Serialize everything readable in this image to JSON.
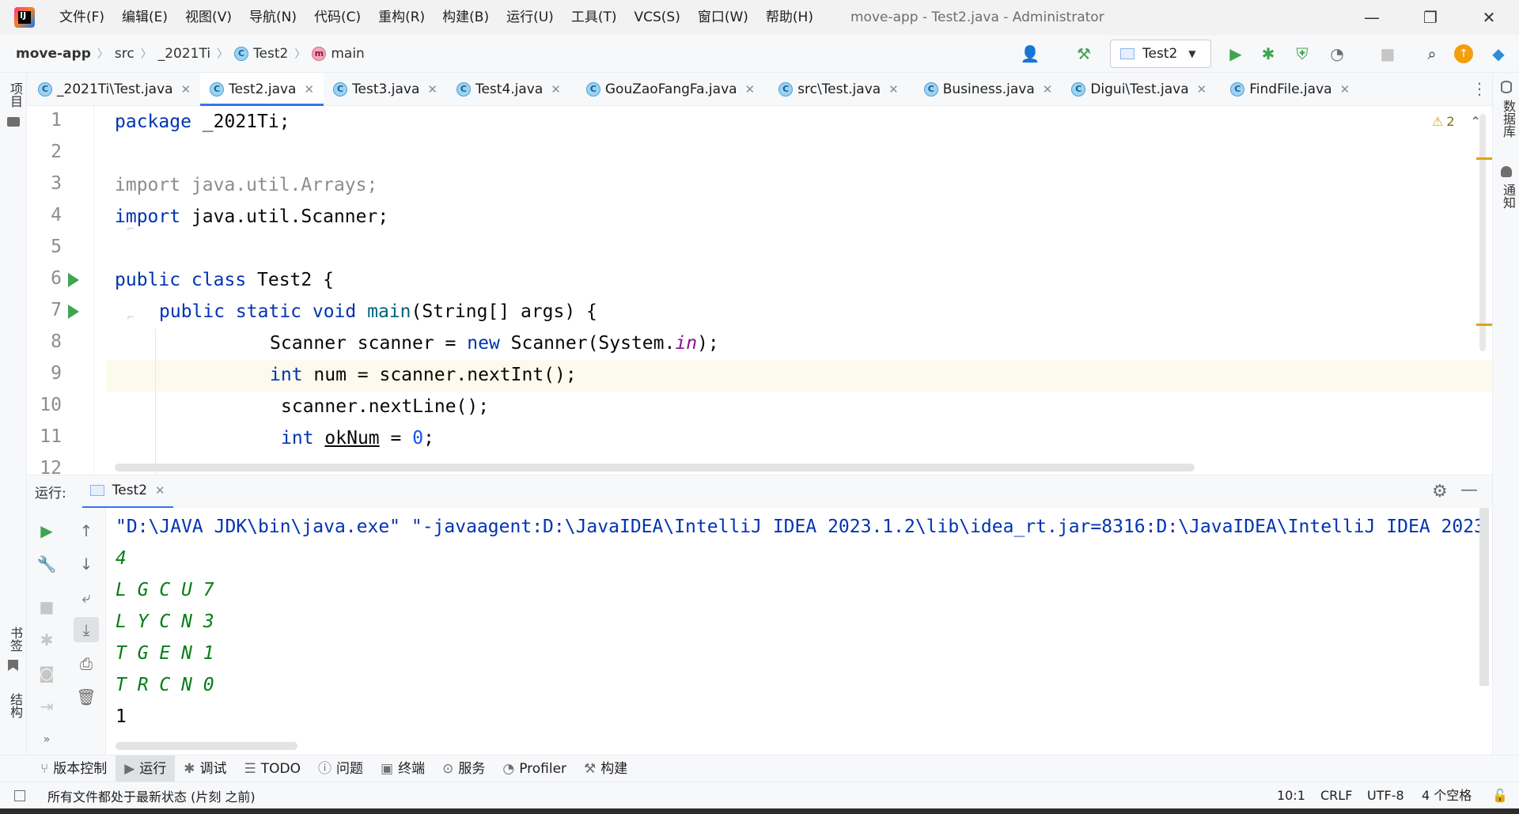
{
  "menu": [
    "文件(F)",
    "编辑(E)",
    "视图(V)",
    "导航(N)",
    "代码(C)",
    "重构(R)",
    "构建(B)",
    "运行(U)",
    "工具(T)",
    "VCS(S)",
    "窗口(W)",
    "帮助(H)"
  ],
  "window_title": "move-app - Test2.java - Administrator",
  "breadcrumb": {
    "project": "move-app",
    "src": "src",
    "package": "_2021Ti",
    "class": "Test2",
    "method": "main"
  },
  "run_config": "Test2",
  "left_stripe": {
    "project": "项目",
    "bookmarks": "书签",
    "structure": "结构"
  },
  "right_stripe": {
    "database": "数据库",
    "notifications": "通知"
  },
  "tabs": [
    {
      "label": "_2021Ti\\Test.java"
    },
    {
      "label": "Test2.java"
    },
    {
      "label": "Test3.java"
    },
    {
      "label": "Test4.java"
    },
    {
      "label": "GouZaoFangFa.java"
    },
    {
      "label": "src\\Test.java"
    },
    {
      "label": "Business.java"
    },
    {
      "label": "Digui\\Test.java"
    },
    {
      "label": "FindFile.java"
    }
  ],
  "warnings": "2",
  "line_numbers": [
    "1",
    "2",
    "3",
    "4",
    "5",
    "6",
    "7",
    "8",
    "9",
    "10",
    "11",
    "12"
  ],
  "code": {
    "l1_kw": "package",
    "l1_rest": " _2021Ti;",
    "l3": "import java.util.Arrays;",
    "l4_kw": "import",
    "l4_rest": " java.util.Scanner;",
    "l6_kw": "public class",
    "l6_rest": " Test2 {",
    "l7_kw": "public static void",
    "l7_fn": "main",
    "l7_rest": "(String[] args) {",
    "l8_a": "Scanner scanner = ",
    "l8_kw": "new",
    "l8_b": " Scanner(System.",
    "l8_field": "in",
    "l8_c": ");",
    "l9_kw": "int",
    "l9_rest": " num = scanner.nextInt();",
    "l10": "scanner.nextLine();",
    "l11_kw": "int",
    "l11_var": "okNum",
    "l11_mid": " = ",
    "l11_num": "0",
    "l11_end": ";"
  },
  "run_panel": {
    "label": "运行:",
    "tab": "Test2"
  },
  "console": {
    "command": "\"D:\\JAVA JDK\\bin\\java.exe\" \"-javaagent:D:\\JavaIDEA\\IntelliJ IDEA 2023.1.2\\lib\\idea_rt.jar=8316:D:\\JavaIDEA\\IntelliJ IDEA 2023",
    "input_lines": [
      "4",
      "L G C U 7",
      "L Y C N 3",
      "T G E N 1",
      "T R C N 0"
    ],
    "output": "1"
  },
  "bottom_tools": [
    "版本控制",
    "运行",
    "调试",
    "TODO",
    "问题",
    "终端",
    "服务",
    "Profiler",
    "构建"
  ],
  "status": {
    "message": "所有文件都处于最新状态 (片刻 之前)",
    "position": "10:1",
    "line_sep": "CRLF",
    "encoding": "UTF-8",
    "indent": "4 个空格"
  },
  "colors": {
    "accent": "#3574f0",
    "run_green": "#3ea552",
    "keyword": "#0033b3"
  }
}
